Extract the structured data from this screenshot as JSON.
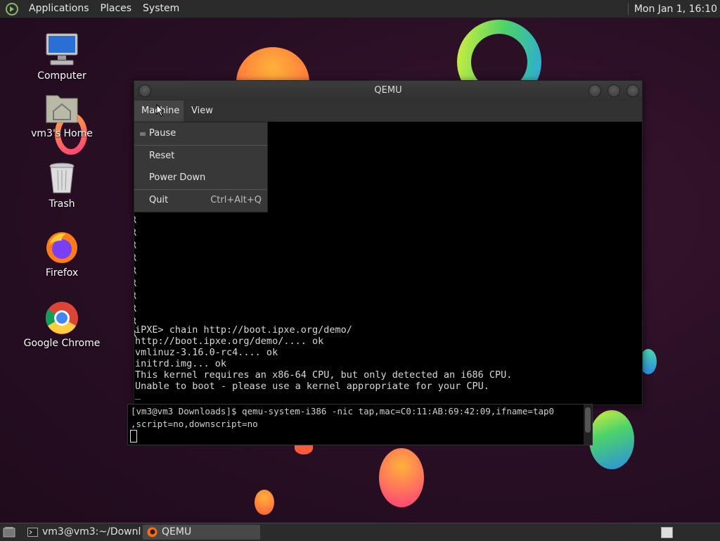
{
  "top_panel": {
    "menus": [
      "Applications",
      "Places",
      "System"
    ],
    "clock": "Mon Jan 1, 16:10"
  },
  "desktop": {
    "icons": [
      {
        "label": "Computer",
        "icon": "computer-icon"
      },
      {
        "label": "vm3's Home",
        "icon": "home-folder-icon"
      },
      {
        "label": "Trash",
        "icon": "trash-icon"
      },
      {
        "label": "Firefox",
        "icon": "firefox-icon"
      },
      {
        "label": "Google Chrome",
        "icon": "chrome-icon"
      }
    ]
  },
  "qemu": {
    "title": "QEMU",
    "menubar": [
      "Machine",
      "View"
    ],
    "machine_menu": {
      "items": [
        {
          "label": "Pause",
          "accel": ""
        },
        {
          "label": "Reset",
          "accel": ""
        },
        {
          "label": "Power Down",
          "accel": ""
        },
        {
          "label": "Quit",
          "accel": "Ctrl+Alt+Q"
        }
      ]
    },
    "console_left_chars": [
      "R",
      "R",
      "R",
      "R",
      "R",
      "R",
      "R",
      "R",
      "R",
      "R",
      "R",
      "R",
      "R",
      "R",
      "R",
      "R"
    ],
    "console": [
      "iPXE> chain http://boot.ipxe.org/demo/",
      "http://boot.ipxe.org/demo/.... ok",
      "vmlinuz-3.16.0-rc4.... ok",
      "initrd.img... ok",
      "This kernel requires an x86-64 CPU, but only detected an i686 CPU.",
      "Unable to boot - please use a kernel appropriate for your CPU.",
      "_"
    ]
  },
  "terminal": {
    "lines": [
      "[vm3@vm3 Downloads]$ qemu-system-i386 -nic tap,mac=C0:11:AB:69:42:09,ifname=tap0",
      ",script=no,downscript=no"
    ]
  },
  "taskbar": {
    "tasks": [
      {
        "label": "vm3@vm3:~/Downl...",
        "icon": "terminal-icon",
        "active": false
      },
      {
        "label": "QEMU",
        "icon": "qemu-icon",
        "active": true
      }
    ]
  }
}
